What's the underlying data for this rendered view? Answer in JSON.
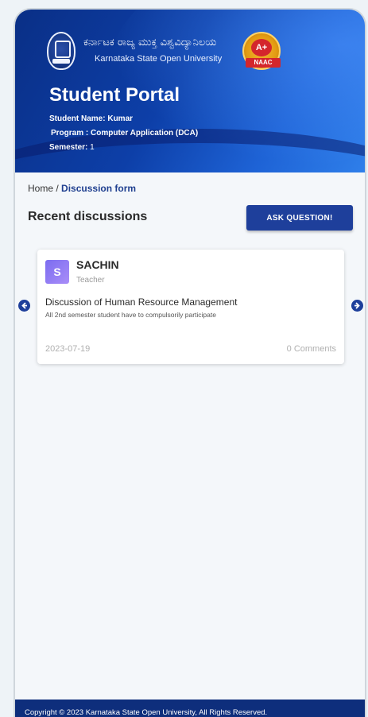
{
  "header": {
    "university_name_kn": "ಕರ್ನಾಟಕ ರಾಜ್ಯ ಮುಕ್ತ ವಿಶ್ವವಿದ್ಯಾನಿಲಯ",
    "university_name_en": "Karnataka State Open University",
    "naac_grade": "A+",
    "naac_label": "NAAC",
    "portal_title": "Student Portal",
    "student_name_label": "Student Name:",
    "student_name": "Kumar",
    "program_text": "Program : Computer Application (DCA)",
    "semester_label": "Semester:",
    "semester": "1"
  },
  "breadcrumb": {
    "home": "Home",
    "separator": "/",
    "current": "Discussion form"
  },
  "main": {
    "section_title": "Recent discussions",
    "ask_button_label": "ASK QUESTION!",
    "prev_icon": "arrow-left-icon",
    "next_icon": "arrow-right-icon"
  },
  "discussion": {
    "avatar_letter": "S",
    "author": "SACHIN",
    "role": "Teacher",
    "title": "Discussion of Human Resource Management",
    "description": "All 2nd semester student have to compulsorily participate",
    "date": "2023-07-19",
    "comments": "0 Comments"
  },
  "footer": {
    "copyright": "Copyright © 2023 Karnataka State Open University, All Rights Reserved."
  },
  "colors": {
    "primary": "#1e3f9b",
    "header_dark": "#0a2f86",
    "header_light": "#2f7fea",
    "footer": "#0e2e7c",
    "avatar": "#8e7cf4"
  }
}
